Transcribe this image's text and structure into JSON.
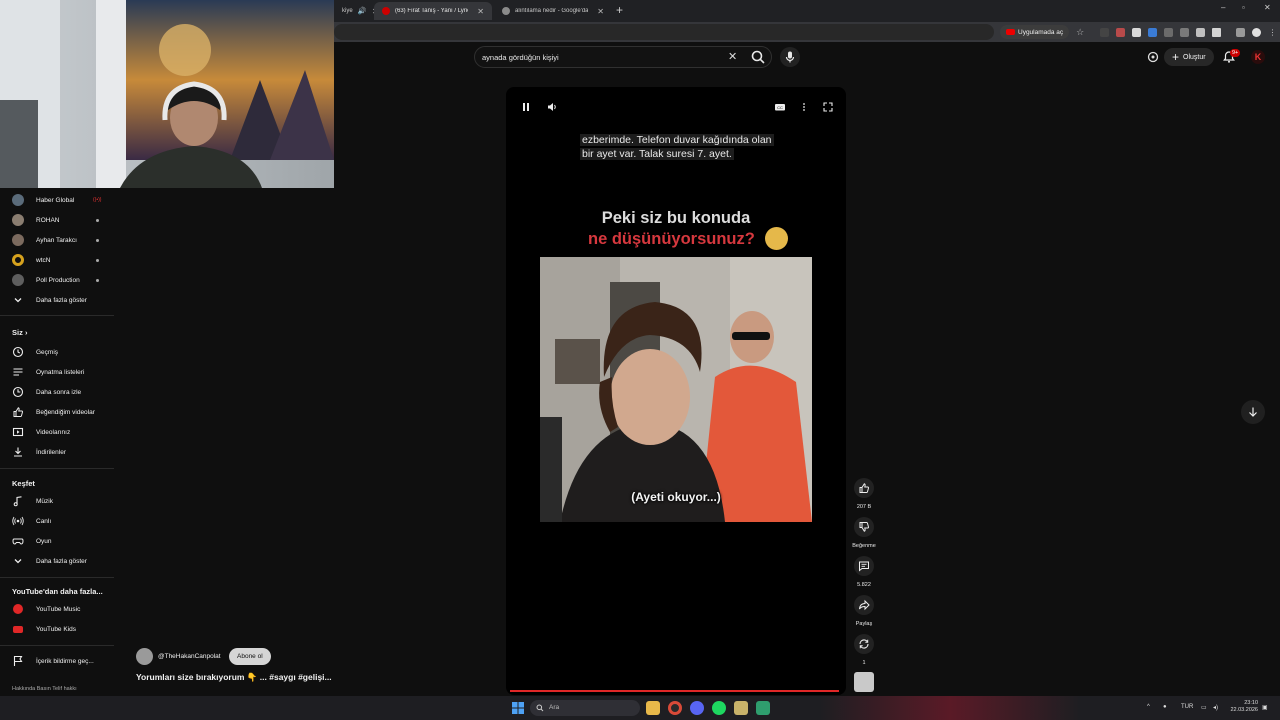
{
  "browser": {
    "tabs": [
      {
        "title": "kiye",
        "favicon_color": "#cc0000",
        "active": false
      },
      {
        "title": "(63) Fırat Tanış - Yanı / Lyric [Of",
        "favicon_color": "#cc0000",
        "active": true
      },
      {
        "title": "alıntılama nedir - Google'da Ara",
        "favicon_color": "#8a8a8a",
        "active": false
      }
    ],
    "open_in_app_label": "Uygulamada aç"
  },
  "header": {
    "search_query": "aynada gördüğün kişiyi",
    "create_label": "Oluştur",
    "notification_count": "9+",
    "account_initial": "K"
  },
  "sidebar": {
    "subscriptions": [
      {
        "label": "Haber Global",
        "avatar_color": "#5a6b7a",
        "live": true
      },
      {
        "label": "ROHAN",
        "avatar_color": "#8a7d70",
        "live": false
      },
      {
        "label": "Ayhan Tarakcı",
        "avatar_color": "#7b6a5e",
        "live": false
      },
      {
        "label": "wtcN",
        "avatar_color": "#d6a21e",
        "live": false
      },
      {
        "label": "Poll Production",
        "avatar_color": "#5e5e5e",
        "live": false
      }
    ],
    "show_more_label": "Daha fazla göster",
    "you_section": "Siz",
    "you_items": [
      {
        "label": "Geçmiş",
        "icon": "history-icon"
      },
      {
        "label": "Oynatma listeleri",
        "icon": "playlist-icon"
      },
      {
        "label": "Daha sonra izle",
        "icon": "watch-later-icon"
      },
      {
        "label": "Beğendiğim videolar",
        "icon": "liked-videos-icon"
      },
      {
        "label": "Videolarınız",
        "icon": "your-videos-icon"
      },
      {
        "label": "İndirilenler",
        "icon": "downloads-icon"
      }
    ],
    "explore_section": "Keşfet",
    "explore_items": [
      {
        "label": "Müzik",
        "icon": "music-icon"
      },
      {
        "label": "Canlı",
        "icon": "live-icon"
      },
      {
        "label": "Oyun",
        "icon": "gaming-icon"
      },
      {
        "label": "Daha fazla göster",
        "icon": "chevron-down-icon"
      }
    ],
    "more_section": "YouTube'dan daha fazla...",
    "more_items": [
      {
        "label": "YouTube Music",
        "icon": "youtube-music-icon"
      },
      {
        "label": "YouTube Kids",
        "icon": "youtube-kids-icon"
      }
    ],
    "report_label": "İçerik bildirme geç...",
    "footer": "Hakkında  Basın  Telif hakkı"
  },
  "short": {
    "subtitle_line1": "ezberimde. Telefon duvar kağıdında olan",
    "subtitle_line2": "bir ayet var. Talak suresi 7. ayet.",
    "question_line1": "Peki siz bu konuda",
    "question_line2": "ne düşünüyorsunuz?",
    "caption": "(Ayeti okuyor...)",
    "progress_fraction": 0.99,
    "channel_name": "@TheHakanCanpolat",
    "subscribe_label": "Abone ol",
    "title": "Yorumları size bırakıyorum 👇 ... #saygı #gelişi..."
  },
  "actions": {
    "like_count": "207 B",
    "dislike_label": "Beğenme",
    "comment_count": "5.822",
    "share_label": "Paylaş",
    "remix_count": "1"
  },
  "taskbar": {
    "search_placeholder": "Ara",
    "language": "TUR",
    "time": "23:10",
    "date": "22.03.2026"
  },
  "colors": {
    "background": "#0f0f0f",
    "accent_red": "#e02727",
    "question_red": "#d6383e"
  }
}
